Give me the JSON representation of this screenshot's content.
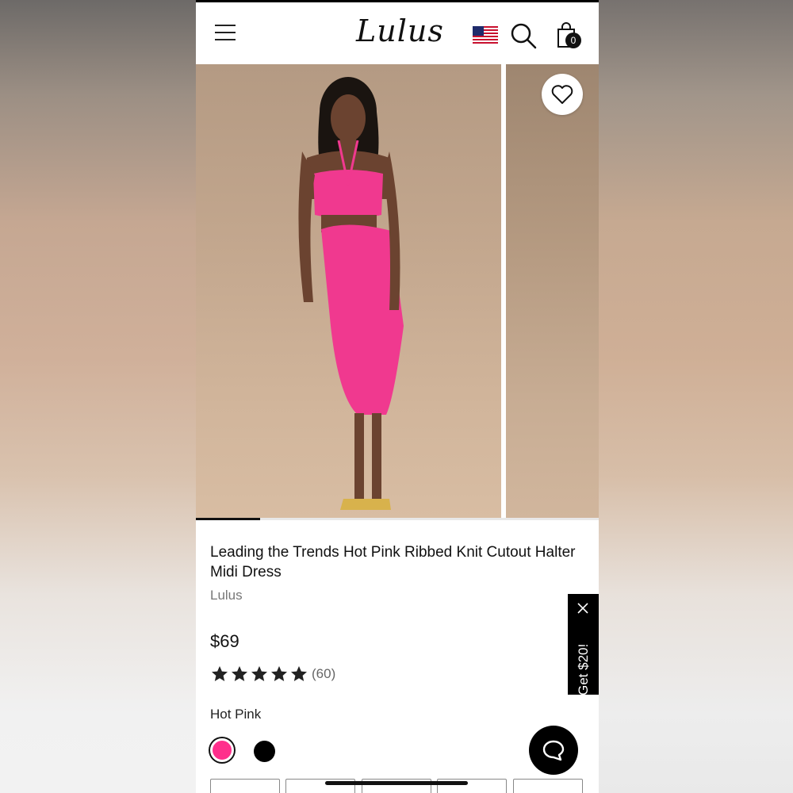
{
  "header": {
    "logo_text": "Lulus",
    "cart_count": "0",
    "icons": [
      "menu-icon",
      "us-flag-icon",
      "search-icon",
      "shopping-bag-icon"
    ]
  },
  "gallery": {
    "progress": 0.16,
    "wishlist_icon": "heart-icon"
  },
  "product": {
    "title": "Leading the Trends Hot Pink Ribbed Knit Cutout Halter Midi Dress",
    "brand": "Lulus",
    "price": "$69",
    "rating": 5,
    "rating_max": 5,
    "review_count": "(60)",
    "selected_color": "Hot Pink"
  },
  "swatches": [
    {
      "name": "Hot Pink",
      "color": "#ff2f8c",
      "selected": true
    },
    {
      "name": "Black",
      "color": "#000000",
      "selected": false
    }
  ],
  "promo": {
    "label": "Get $20!",
    "close_icon": "close-icon"
  },
  "chat": {
    "icon": "chat-bubble-icon"
  },
  "colors": {
    "accent": "#ff2f8c",
    "text": "#111111",
    "muted": "#777777"
  }
}
